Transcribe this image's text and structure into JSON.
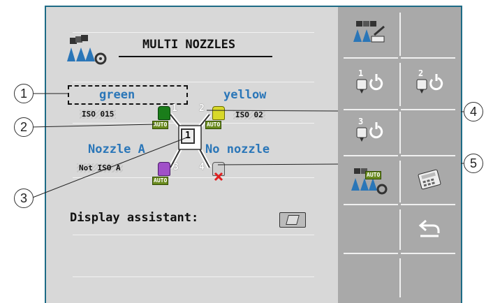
{
  "header": {
    "title": "MULTI NOZZLES"
  },
  "nozzles": [
    {
      "name": "green",
      "iso": "ISO 015",
      "position": "1",
      "auto": "AUTO",
      "color": "#1a7d1a",
      "name_color": "#2a76b8"
    },
    {
      "name": "yellow",
      "iso": "ISO 02",
      "position": "2",
      "auto": "AUTO",
      "color": "#d8d82a",
      "name_color": "#2a76b8"
    },
    {
      "name": "Nozzle A",
      "iso": "Not ISO A",
      "position": "3",
      "auto": "AUTO",
      "color": "#a050c8",
      "name_color": "#2a76b8"
    },
    {
      "name": "No nozzle",
      "iso": "",
      "position": "4",
      "auto": "",
      "color": "#cccccc",
      "name_color": "#2a76b8"
    }
  ],
  "center_indicator": "1",
  "display_assistant": {
    "label": "Display assistant:"
  },
  "callouts": [
    "1",
    "2",
    "3",
    "4",
    "5"
  ],
  "sidebar": {
    "buttons": [
      {
        "id": "nozzle-overview",
        "icon": "multi-nozzle-edit-icon"
      },
      {
        "id": "nozzle-1-power",
        "icon": "nozzle-power-icon",
        "number": "1"
      },
      {
        "id": "nozzle-2-power",
        "icon": "nozzle-power-icon",
        "number": "2"
      },
      {
        "id": "nozzle-3-power",
        "icon": "nozzle-power-icon",
        "number": "3"
      },
      {
        "id": "auto-nozzle-settings",
        "icon": "multi-nozzle-auto-settings-icon",
        "auto": "AUTO"
      },
      {
        "id": "calculator",
        "icon": "calculator-icon"
      },
      {
        "id": "back",
        "icon": "back-arrow-icon"
      }
    ]
  },
  "colors": {
    "frame": "#1d6b86",
    "main_bg": "#d8d8d8",
    "side_bg": "#a9a9a9",
    "accent_blue": "#2a76b8"
  }
}
